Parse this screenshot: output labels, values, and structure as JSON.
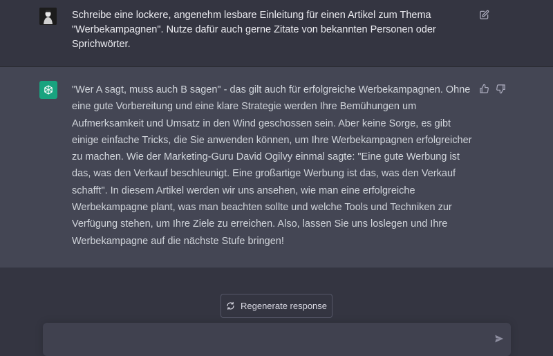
{
  "conversation": {
    "user_message": "Schreibe eine lockere, angenehm lesbare Einleitung für einen Artikel zum Thema \"Werbekampagnen\". Nutze dafür auch gerne Zitate von bekannten Personen oder Sprichwörter.",
    "assistant_message": "\"Wer A sagt, muss auch B sagen\" - das gilt auch für erfolgreiche Werbekampagnen. Ohne eine gute Vorbereitung und eine klare Strategie werden Ihre Bemühungen um Aufmerksamkeit und Umsatz in den Wind geschossen sein. Aber keine Sorge, es gibt einige einfache Tricks, die Sie anwenden können, um Ihre Werbekampagnen erfolgreicher zu machen. Wie der Marketing-Guru David Ogilvy einmal sagte: \"Eine gute Werbung ist das, was den Verkauf beschleunigt. Eine großartige Werbung ist das, was den Verkauf schafft\". In diesem Artikel werden wir uns ansehen, wie man eine erfolgreiche Werbekampagne plant, was man beachten sollte und welche Tools und Techniken zur Verfügung stehen, um Ihre Ziele zu erreichen. Also, lassen Sie uns loslegen und Ihre Werbekampagne auf die nächste Stufe bringen!"
  },
  "controls": {
    "regenerate_label": "Regenerate response",
    "input_value": ""
  },
  "icons": {
    "edit": "edit-icon",
    "thumbs_up": "thumbs-up-icon",
    "thumbs_down": "thumbs-down-icon",
    "regenerate": "refresh-icon",
    "send": "send-icon",
    "assistant_logo": "openai-logo-icon"
  },
  "colors": {
    "background": "#343541",
    "assistant_background": "#444654",
    "assistant_avatar": "#19a37f"
  }
}
